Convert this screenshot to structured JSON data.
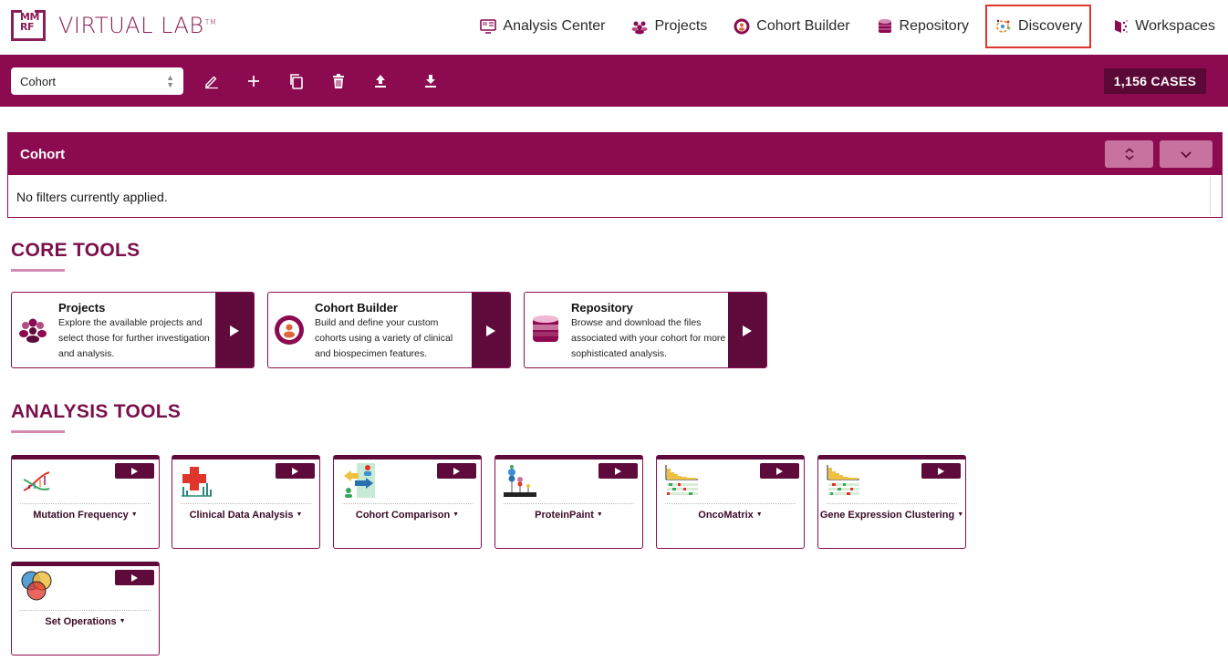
{
  "brand": {
    "logo_letters_1": "MM",
    "logo_letters_2": "RF",
    "name": "VIRTUAL LAB",
    "tm": "TM"
  },
  "nav": [
    {
      "label": "Analysis Center",
      "icon": "analysis-center-icon"
    },
    {
      "label": "Projects",
      "icon": "projects-icon"
    },
    {
      "label": "Cohort Builder",
      "icon": "cohort-builder-icon"
    },
    {
      "label": "Repository",
      "icon": "repository-icon"
    },
    {
      "label": "Discovery",
      "icon": "discovery-icon",
      "highlighted": true
    },
    {
      "label": "Workspaces",
      "icon": "workspaces-icon"
    }
  ],
  "cohort_bar": {
    "selected_cohort": "Cohort",
    "actions": [
      "edit-icon",
      "plus-icon",
      "copy-icon",
      "trash-icon",
      "upload-icon",
      "download-icon"
    ],
    "cases_badge": "1,156 CASES"
  },
  "cohort_panel": {
    "title": "Cohort",
    "empty_message": "No filters currently applied."
  },
  "core_tools": {
    "heading": "CORE TOOLS",
    "cards": [
      {
        "title": "Projects",
        "description": "Explore the available projects and select those for further investigation and analysis.",
        "icon": "projects-icon"
      },
      {
        "title": "Cohort Builder",
        "description": "Build and define your custom cohorts using a variety of clinical and biospecimen features.",
        "icon": "cohort-builder-icon"
      },
      {
        "title": "Repository",
        "description": "Browse and download the files associated with your cohort for more sophisticated analysis.",
        "icon": "repository-icon"
      }
    ]
  },
  "analysis_tools": {
    "heading": "ANALYSIS TOOLS",
    "cards": [
      {
        "label": "Mutation Frequency",
        "icon": "dna-icon"
      },
      {
        "label": "Clinical Data Analysis",
        "icon": "clinical-cross-icon"
      },
      {
        "label": "Cohort Comparison",
        "icon": "cohort-comparison-icon"
      },
      {
        "label": "ProteinPaint",
        "icon": "protein-paint-icon"
      },
      {
        "label": "OncoMatrix",
        "icon": "onco-matrix-icon"
      },
      {
        "label": "Gene Expression Clustering",
        "icon": "gene-expression-icon"
      },
      {
        "label": "Set Operations",
        "icon": "venn-diagram-icon"
      }
    ]
  },
  "colors": {
    "primary": "#8b0a50",
    "dark": "#5e0a3a",
    "accent_light": "#c8729f",
    "highlight_border": "#e0352b"
  }
}
